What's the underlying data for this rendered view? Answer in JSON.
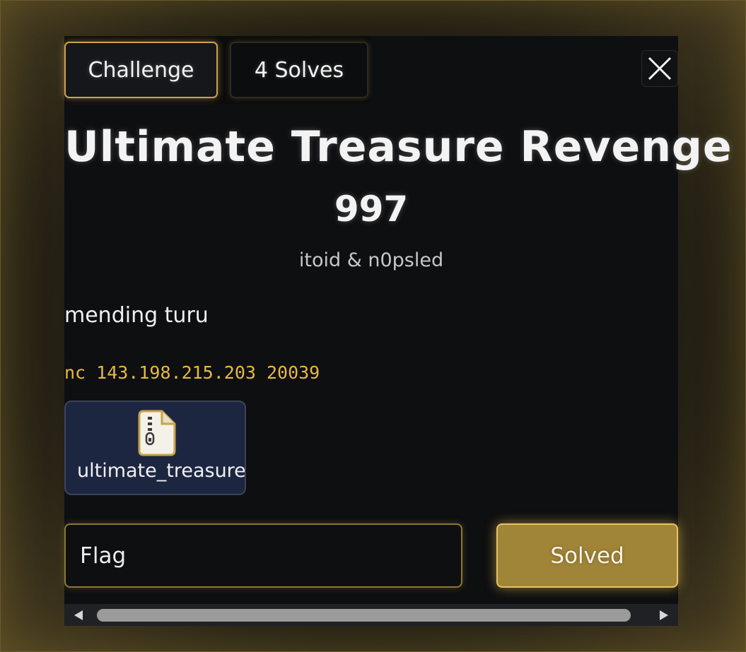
{
  "tabs": [
    {
      "label": "Challenge",
      "active": true
    },
    {
      "label": "4 Solves",
      "active": false
    }
  ],
  "close_icon": "close-icon",
  "challenge": {
    "title": "Ultimate Treasure Revenge",
    "points": "997",
    "authors": "itoid & n0psled",
    "description": "mending turu",
    "command": "nc 143.198.215.203 20039"
  },
  "attachment": {
    "icon": "zip-file-icon",
    "name": "ultimate_treasure_"
  },
  "flag_form": {
    "placeholder": "Flag",
    "button_label": "Solved"
  },
  "colors": {
    "accent": "#c9a34a",
    "command": "#e8b842",
    "solved_button": "#a08538",
    "file_card": "#1d2641"
  },
  "scrollbar": {
    "left_arrow": "scroll-left-icon",
    "right_arrow": "scroll-right-icon"
  }
}
